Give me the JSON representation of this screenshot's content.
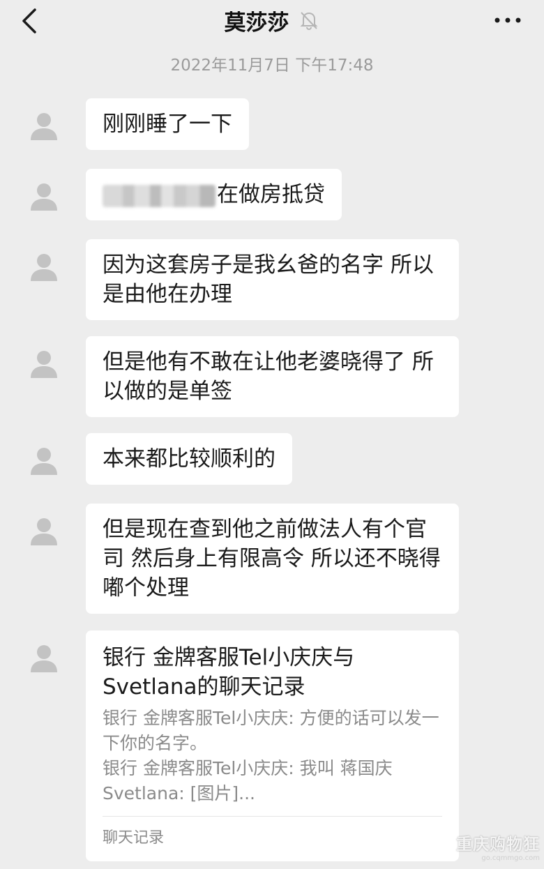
{
  "header": {
    "title": "莫莎莎",
    "back_icon": "chevron-left-icon",
    "mute_icon": "bell-off-icon",
    "more_icon": "ellipsis-icon"
  },
  "timestamp": "2022年11月7日 下午17:48",
  "messages": [
    {
      "text": "刚刚睡了一下"
    },
    {
      "text": "在做房抵贷"
    },
    {
      "text": "因为这套房子是我幺爸的名字 所以是由他在办理"
    },
    {
      "text": "但是他有不敢在让他老婆晓得了 所以做的是单签"
    },
    {
      "text": "本来都比较顺利的"
    },
    {
      "text": "但是现在查到他之前做法人有个官司 然后身上有限高令 所以还不晓得嘟个处理"
    }
  ],
  "chat_record": {
    "title": "银行 金牌客服Tel小庆庆与Svetlana的聊天记录",
    "lines": [
      "银行 金牌客服Tel小庆庆: 方便的话可以发一下你的名字。",
      "银行 金牌客服Tel小庆庆: 我叫 蒋国庆",
      "Svetlana: [图片]..."
    ],
    "footer": "聊天记录"
  },
  "watermark": {
    "main": "重庆购物狂",
    "sub": "go.cqmmgo.com"
  },
  "colors": {
    "background": "#ededed",
    "bubble": "#ffffff",
    "muted_text": "#9a9a9a"
  }
}
